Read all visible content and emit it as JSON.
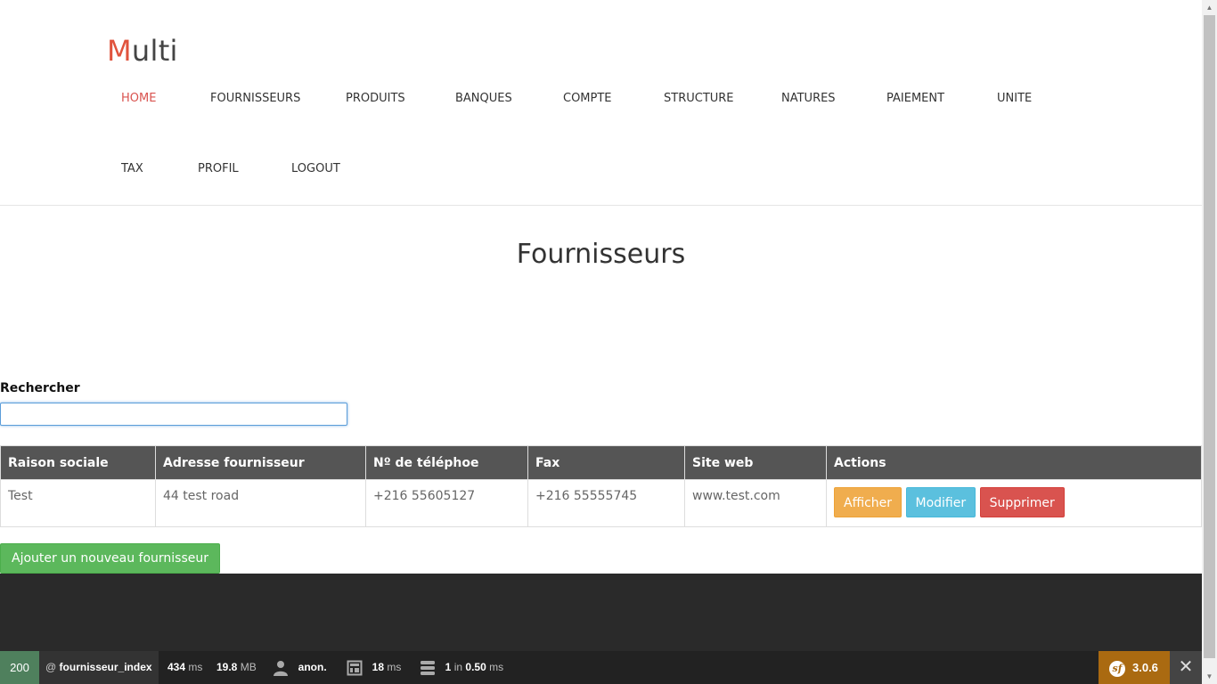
{
  "app": {
    "logo_first": "M",
    "logo_rest": "ulti"
  },
  "nav": {
    "items": [
      {
        "label": "HOME",
        "active": true
      },
      {
        "label": "FOURNISSEURS"
      },
      {
        "label": "PRODUITS"
      },
      {
        "label": "BANQUES"
      },
      {
        "label": "COMPTE"
      },
      {
        "label": "STRUCTURE"
      },
      {
        "label": "NATURES"
      },
      {
        "label": "PAIEMENT"
      },
      {
        "label": "UNITE"
      },
      {
        "label": "TAX"
      },
      {
        "label": "PROFIL"
      },
      {
        "label": "LOGOUT"
      }
    ]
  },
  "main": {
    "title": "Fournisseurs",
    "search_label": "Rechercher",
    "search_value": "",
    "table": {
      "headers": [
        "Raison sociale",
        "Adresse fournisseur",
        "Nº de téléphoe",
        "Fax",
        "Site web",
        "Actions"
      ],
      "rows": [
        {
          "raison_sociale": "Test",
          "adresse": "44 test road",
          "telephone": "+216 55605127",
          "fax": "+216 55555745",
          "site_web": "www.test.com",
          "btn_show": "Afficher",
          "btn_edit": "Modifier",
          "btn_delete": "Supprimer"
        }
      ]
    },
    "add_button": "Ajouter un nouveau fournisseur"
  },
  "toolbar": {
    "status_code": "200",
    "route_at": "@",
    "route": "fournisseur_index",
    "time_value": "434",
    "time_unit": "ms",
    "memory_value": "19.8",
    "memory_unit": "MB",
    "user": "anon.",
    "render_value": "18",
    "render_unit": "ms",
    "db_count": "1",
    "db_in": "in",
    "db_time": "0.50",
    "db_unit": "ms",
    "version": "3.0.6",
    "sf_logo": "sf"
  },
  "colors": {
    "accent_red": "#e0533d",
    "status_green": "#4f805d",
    "version_orange": "#aa6a11",
    "btn_show": "#f0ad4e",
    "btn_edit": "#5bc0de",
    "btn_delete": "#d9534f",
    "btn_add": "#5cb85c"
  }
}
